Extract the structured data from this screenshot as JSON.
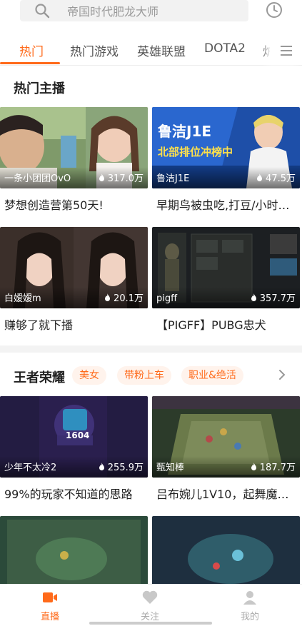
{
  "search": {
    "placeholder": "帝国时代肥龙大师"
  },
  "tabs": [
    {
      "label": "热门",
      "active": true
    },
    {
      "label": "热门游戏"
    },
    {
      "label": "英雄联盟"
    },
    {
      "label": "DOTA2"
    },
    {
      "label": "炉"
    }
  ],
  "sections": [
    {
      "title": "热门主播",
      "cards": [
        {
          "streamer": "一条小团团OvO",
          "views": "317.0万",
          "title": "梦想创造营第50天!"
        },
        {
          "streamer": "鲁洁J1E",
          "views": "47.5万",
          "title": "早期鸟被虫吃,打豆/小时…",
          "thumb_text": "鲁洁J1E",
          "thumb_banner": "北部排位冲榜中"
        },
        {
          "streamer": "白嫒嫒m",
          "views": "20.1万",
          "title": "赚够了就下播"
        },
        {
          "streamer": "pigff",
          "views": "357.7万",
          "title": "【PIGFF】PUBG忠犬"
        }
      ]
    },
    {
      "title": "王者荣耀",
      "chips": [
        "美女",
        "带粉上车",
        "职业&绝活"
      ],
      "cards": [
        {
          "streamer": "少年不太冷2",
          "views": "255.9万",
          "title": "99%的玩家不知道的思路",
          "thumb_text": "1604"
        },
        {
          "streamer": "甄知棒",
          "views": "187.7万",
          "title": "吕布婉儿1V10，起舞魔…"
        },
        {
          "streamer": "",
          "views": "",
          "title": ""
        },
        {
          "streamer": "",
          "views": "",
          "title": ""
        }
      ]
    }
  ],
  "bottom_nav": [
    {
      "label": "直播",
      "icon": "tv-icon",
      "active": true
    },
    {
      "label": "关注",
      "icon": "heart-icon"
    },
    {
      "label": "我的",
      "icon": "user-icon"
    }
  ],
  "colors": {
    "accent": "#ff6a1a",
    "muted": "#aaaaaa"
  }
}
